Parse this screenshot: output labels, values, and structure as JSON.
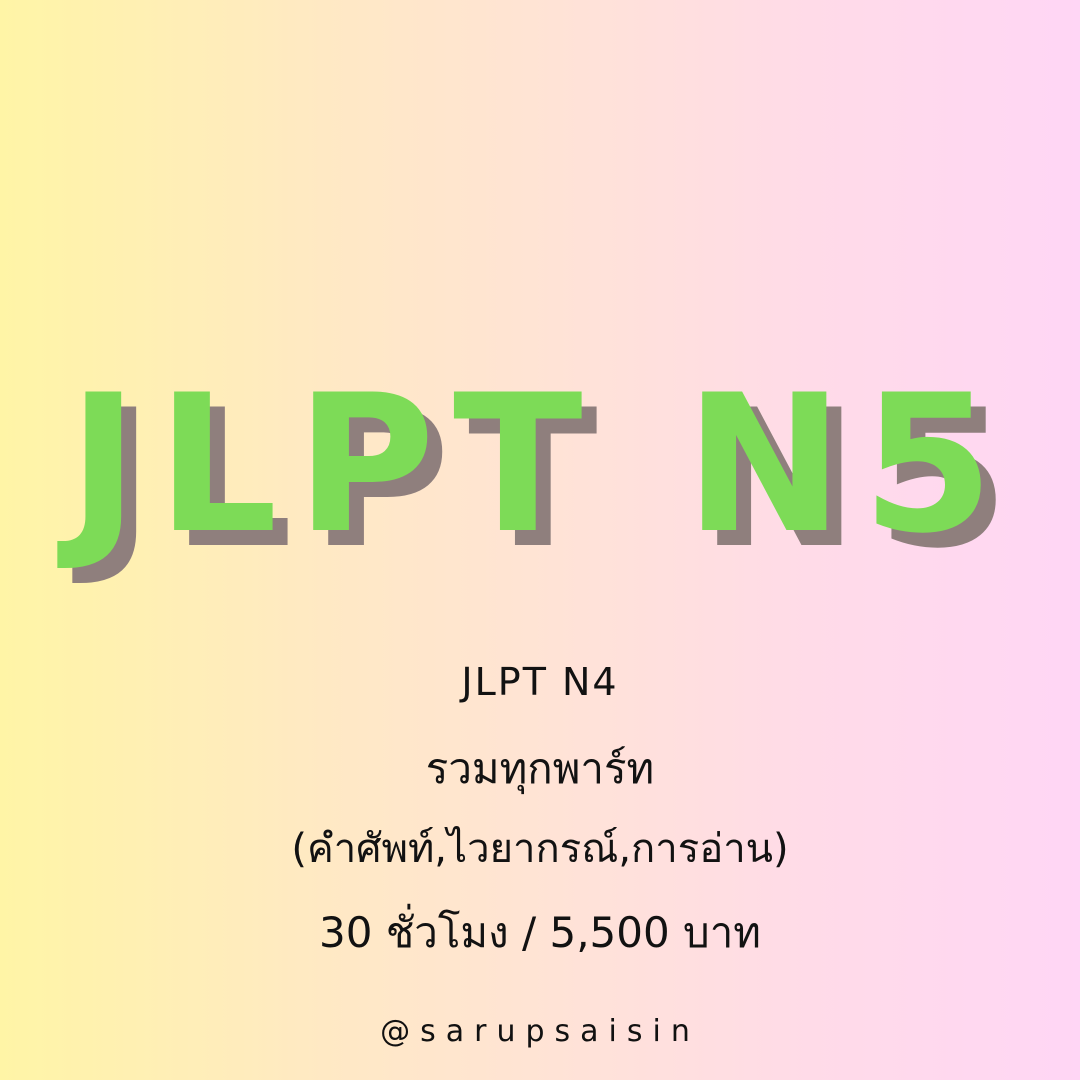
{
  "poster": {
    "headline": "JLPT N5",
    "lines": [
      "JLPT N4",
      "รวมทุกพาร์ท",
      "(คำศัพท์,ไวยากรณ์,การอ่าน)",
      "30 ชั่วโมง / 5,500 บาท"
    ],
    "handle": "@sarupsaisin"
  },
  "colors": {
    "headline": "#7ddb57",
    "headline_shadow": "#8f7f7d",
    "gradient_left": "#fff5a6",
    "gradient_right": "#ffd6f5",
    "text": "#121212"
  }
}
